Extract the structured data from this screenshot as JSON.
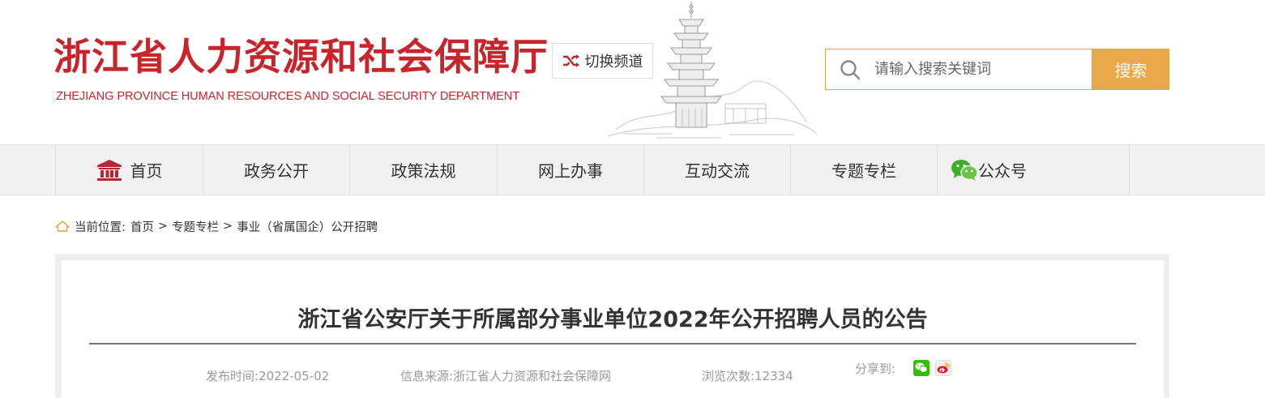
{
  "header": {
    "logo_cn": "浙江省人力资源和社会保障厅",
    "logo_en": "ZHEJIANG PROVINCE HUMAN RESOURCES AND SOCIAL SECURITY DEPARTMENT",
    "switch_channel": "切换频道"
  },
  "search": {
    "placeholder": "请输入搜索关键词",
    "button": "搜索"
  },
  "nav": {
    "items": [
      {
        "label": "首页",
        "icon": "home-building-icon"
      },
      {
        "label": "政务公开"
      },
      {
        "label": "政策法规"
      },
      {
        "label": "网上办事"
      },
      {
        "label": "互动交流"
      },
      {
        "label": "专题专栏"
      },
      {
        "label": "公众号",
        "icon": "wechat-icon"
      }
    ]
  },
  "breadcrumb": {
    "prefix": "当前位置:",
    "items": [
      "首页",
      "专题专栏",
      "事业（省属国企）公开招聘"
    ],
    "separator": ">"
  },
  "article": {
    "title": "浙江省公安厅关于所属部分事业单位2022年公开招聘人员的公告",
    "publish_time": "发布时间:2022-05-02",
    "source": "信息来源:浙江省人力资源和社会保障网",
    "views": "浏览次数:12334",
    "share_label": "分享到:"
  },
  "colors": {
    "brand_red": "#c8242b",
    "accent_orange": "#e9a84a",
    "wechat_green": "#2dc100",
    "weibo_orange": "#f5a623"
  }
}
